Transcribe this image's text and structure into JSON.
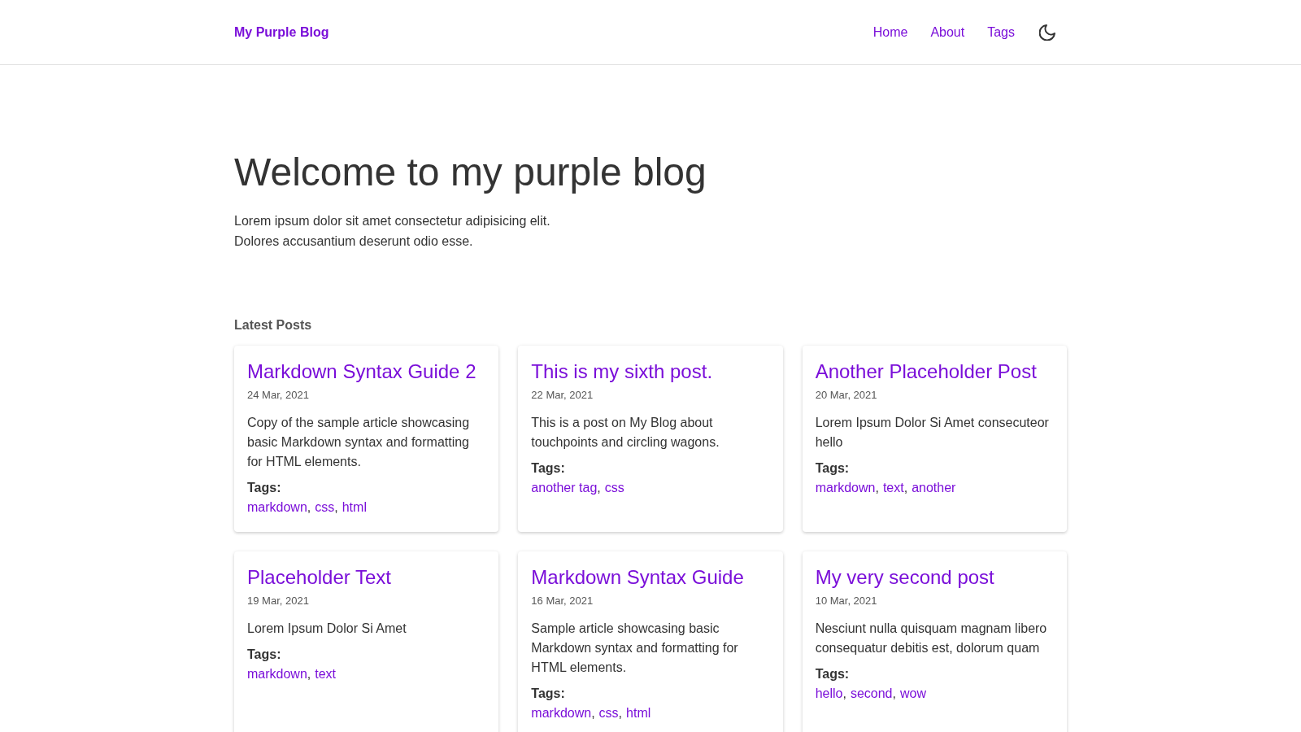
{
  "header": {
    "logo": "My Purple Blog",
    "nav": [
      {
        "label": "Home"
      },
      {
        "label": "About"
      },
      {
        "label": "Tags"
      }
    ]
  },
  "hero": {
    "title": "Welcome to my purple blog",
    "intro_lines": [
      "Lorem ipsum dolor sit amet consectetur adipisicing elit.",
      "Dolores accusantium deserunt odio esse."
    ]
  },
  "latest_posts": {
    "heading": "Latest Posts",
    "tag_separator": ",",
    "posts": [
      {
        "title": "Markdown Syntax Guide 2",
        "date": "24 Mar, 2021",
        "summary": "Copy of the sample article showcasing basic Markdown syntax and formatting for HTML elements.",
        "tags_label": "Tags:",
        "tags": [
          "markdown",
          "css",
          "html"
        ]
      },
      {
        "title": "This is my sixth post.",
        "date": "22 Mar, 2021",
        "summary": "This is a post on My Blog about touchpoints and circling wagons.",
        "tags_label": "Tags:",
        "tags": [
          "another tag",
          "css"
        ]
      },
      {
        "title": "Another Placeholder Post",
        "date": "20 Mar, 2021",
        "summary": "Lorem Ipsum Dolor Si Amet consecuteor hello",
        "tags_label": "Tags:",
        "tags": [
          "markdown",
          "text",
          "another"
        ]
      },
      {
        "title": "Placeholder Text",
        "date": "19 Mar, 2021",
        "summary": "Lorem Ipsum Dolor Si Amet",
        "tags_label": "Tags:",
        "tags": [
          "markdown",
          "text"
        ]
      },
      {
        "title": "Markdown Syntax Guide",
        "date": "16 Mar, 2021",
        "summary": "Sample article showcasing basic Markdown syntax and formatting for HTML elements.",
        "tags_label": "Tags:",
        "tags": [
          "markdown",
          "css",
          "html"
        ]
      },
      {
        "title": "My very second post",
        "date": "10 Mar, 2021",
        "summary": "Nesciunt nulla quisquam magnam libero consequatur debitis est, dolorum quam",
        "tags_label": "Tags:",
        "tags": [
          "hello",
          "second",
          "wow"
        ]
      }
    ]
  }
}
